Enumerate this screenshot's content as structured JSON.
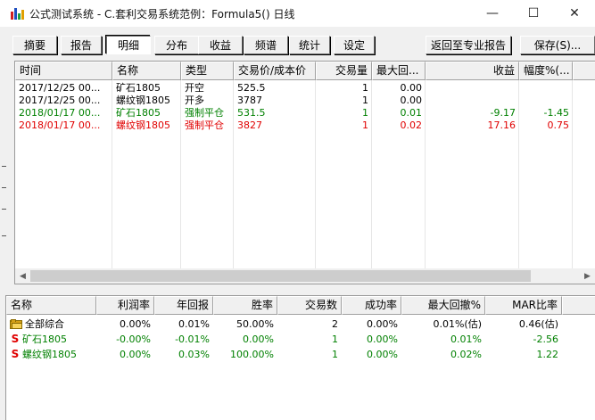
{
  "window": {
    "title": "公式测试系统 - C.套利交易系统范例：Formula5() 日线",
    "minimize_glyph": "—",
    "maximize_glyph": "☐",
    "close_glyph": "✕"
  },
  "toolbar": {
    "tabs": [
      {
        "label": "摘要"
      },
      {
        "label": "报告"
      },
      {
        "label": "明细",
        "active": true
      },
      {
        "label": "分布"
      },
      {
        "label": "收益"
      },
      {
        "label": "频谱"
      },
      {
        "label": "统计"
      },
      {
        "label": "设定"
      }
    ],
    "return_label": "返回至专业报告",
    "save_label": "保存(S)..."
  },
  "trades": {
    "columns": [
      "时间",
      "名称",
      "类型",
      "交易价/成本价",
      "交易量",
      "最大回...",
      "收益",
      "幅度%(..."
    ],
    "rows": [
      {
        "time": "2017/12/25 00...",
        "name": "矿石1805",
        "type": "开空",
        "price": "525.5",
        "qty": "1",
        "maxdd": "0.00",
        "profit": "",
        "pct": "",
        "color": "black"
      },
      {
        "time": "2017/12/25 00...",
        "name": "螺纹钢1805",
        "type": "开多",
        "price": "3787",
        "qty": "1",
        "maxdd": "0.00",
        "profit": "",
        "pct": "",
        "color": "black"
      },
      {
        "time": "2018/01/17 00...",
        "name": "矿石1805",
        "type": "强制平仓",
        "price": "531.5",
        "qty": "1",
        "maxdd": "0.01",
        "profit": "-9.17",
        "pct": "-1.45",
        "color": "green"
      },
      {
        "time": "2018/01/17 00...",
        "name": "螺纹钢1805",
        "type": "强制平仓",
        "price": "3827",
        "qty": "1",
        "maxdd": "0.02",
        "profit": "17.16",
        "pct": "0.75",
        "color": "red"
      }
    ],
    "scroll_left_glyph": "◀",
    "scroll_right_glyph": "▶"
  },
  "summary": {
    "columns": [
      "名称",
      "利润率",
      "年回报",
      "胜率",
      "交易数",
      "成功率",
      "最大回撤%",
      "MAR比率"
    ],
    "rows": [
      {
        "icon": "folder-icon",
        "name": "全部综合",
        "profit_rate": "0.00%",
        "annual": "0.01%",
        "win": "50.00%",
        "trades": "2",
        "success": "0.00%",
        "maxdd": "0.01%(估)",
        "mar": "0.46(估)",
        "color": "black"
      },
      {
        "icon": "s-icon",
        "icon_text": "S",
        "name": "矿石1805",
        "profit_rate": "-0.00%",
        "annual": "-0.01%",
        "win": "0.00%",
        "trades": "1",
        "success": "0.00%",
        "maxdd": "0.01%",
        "mar": "-2.56",
        "color": "green"
      },
      {
        "icon": "s-icon",
        "icon_text": "S",
        "name": "螺纹钢1805",
        "profit_rate": "0.00%",
        "annual": "0.03%",
        "win": "100.00%",
        "trades": "1",
        "success": "0.00%",
        "maxdd": "0.02%",
        "mar": "1.22",
        "color": "green"
      }
    ]
  },
  "colors": {
    "profit_green": "#008000",
    "loss_red": "#e00000",
    "window_bg": "#f0f0f0"
  }
}
